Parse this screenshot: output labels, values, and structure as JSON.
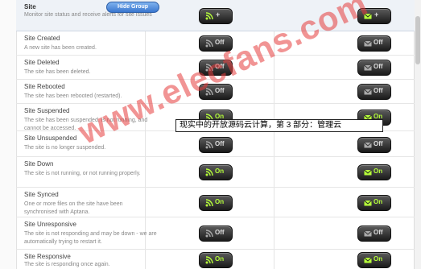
{
  "header": {
    "title": "Site",
    "description": "Monitor site status and receive alerts for site issues",
    "hide_group_label": "Hide Group",
    "rss_toggle_label": "+",
    "mail_toggle_label": "+"
  },
  "events": [
    {
      "title": "Site Created",
      "description": "A new site has been created.",
      "rss": "Off",
      "mail": "Off"
    },
    {
      "title": "Site Deleted",
      "description": "The site has been deleted.",
      "rss": "Off",
      "mail": "Off"
    },
    {
      "title": "Site Rebooted",
      "description": "The site has been rebooted (restarted).",
      "rss": "Off",
      "mail": "Off"
    },
    {
      "title": "Site Suspended",
      "description": "The site has been suspended, is not running, and cannot be accessed.",
      "rss": "On",
      "mail": "On"
    },
    {
      "title": "Site Unsuspended",
      "description": "The site is no longer suspended.",
      "rss": "Off",
      "mail": "Off"
    },
    {
      "title": "Site Down",
      "description": "The site is not running, or not running properly.",
      "rss": "On",
      "mail": "On"
    },
    {
      "title": "Site Synced",
      "description": "One or more files on the site have been synchronised with Aptana.",
      "rss": "On",
      "mail": "On"
    },
    {
      "title": "Site Unresponsive",
      "description": "The site is not responding and may be down - we are automatically trying to restart it.",
      "rss": "Off",
      "mail": "Off"
    },
    {
      "title": "Site Responsive",
      "description": "The site is responding once again.",
      "rss": "On",
      "mail": "On"
    }
  ],
  "overlay_caption": "现实中的开放源码云计算，第 3 部分：管理云",
  "watermark": "www.elecfans.com",
  "colors": {
    "on_label": "#b6ff3a",
    "off_label": "#dddddd",
    "toggle_bg": "#2a2a2a",
    "header_bg": "#eef2f7",
    "watermark": "#e63c3c"
  }
}
